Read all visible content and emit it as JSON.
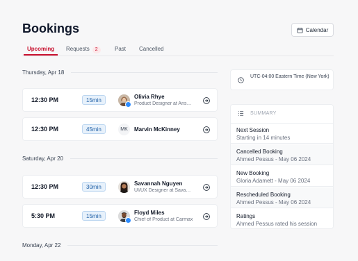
{
  "header": {
    "title": "Bookings",
    "calendar_label": "Calendar"
  },
  "tabs": [
    {
      "label": "Upcoming"
    },
    {
      "label": "Requests",
      "badge": "2"
    },
    {
      "label": "Past"
    },
    {
      "label": "Cancelled"
    }
  ],
  "days": [
    {
      "label": "Thursday, Apr 18"
    },
    {
      "label": "Saturday, Apr 20"
    },
    {
      "label": "Monday, Apr 22"
    }
  ],
  "bookings": [
    {
      "time": "12:30 PM",
      "duration": "15min",
      "name": "Olivia Rhye",
      "role": "Product Designer at Anse..."
    },
    {
      "time": "12:30 PM",
      "duration": "45min",
      "name": "Marvin McKinney",
      "initials": "MK"
    },
    {
      "time": "12:30 PM",
      "duration": "30min",
      "name": "Savannah Nguyen",
      "role": "UI/UX Designer at Savann..."
    },
    {
      "time": "5:30 PM",
      "duration": "15min",
      "name": "Floyd Miles",
      "role": "Chief of Product at Carmax"
    }
  ],
  "timezone": "UTC-04:00 Eastern Time (New York)",
  "summary": {
    "label": "SUMMARY",
    "items": [
      {
        "title": "Next Session",
        "sub": "Starting in 14 minutes"
      },
      {
        "title": "Cancelled Booking",
        "sub": "Ahmed Pessus - May 06 2024"
      },
      {
        "title": "New Booking",
        "sub": "Gloria Adamett - May 06 2024"
      },
      {
        "title": "Rescheduled Booking",
        "sub": "Ahmed Pessus - May 06 2024"
      },
      {
        "title": "Ratings",
        "sub": "Ahmed Pessus rated his session"
      }
    ]
  },
  "colors": {
    "accent": "#c8102e",
    "duration_bg": "#e7f1fb",
    "verified": "#2d8cff"
  },
  "icons": {
    "calendar": "calendar-icon",
    "clock": "clock-icon",
    "list": "list-icon",
    "go": "arrow-right-circle-icon",
    "verified": "verified-badge-icon"
  }
}
